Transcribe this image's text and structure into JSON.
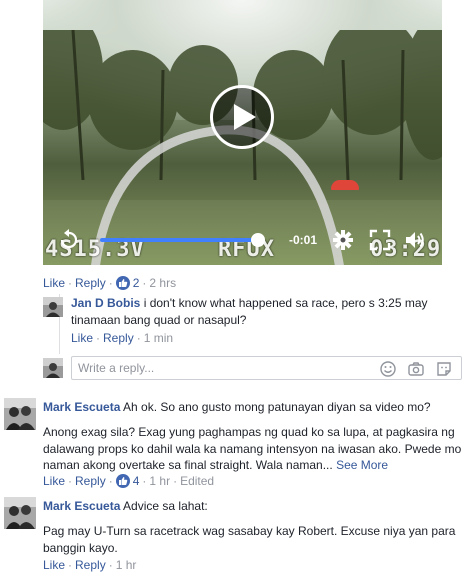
{
  "video": {
    "osd_left": "4S15.3V",
    "osd_mid": "RFUX",
    "osd_right": "03:29",
    "time_remaining": "-0:01",
    "progress_fraction": 0.96,
    "icons": [
      "play-icon",
      "rewind-icon",
      "gear-icon",
      "fullscreen-icon",
      "volume-icon"
    ]
  },
  "comment0": {
    "like": "Like",
    "reply": "Reply",
    "reactions": "2",
    "time": "2 hrs"
  },
  "reply_jan": {
    "author": "Jan D Bobis",
    "text": "i don't know what happened sa race, pero s 3:25 may tinamaan bang quad or nasapul?",
    "like": "Like",
    "reply": "Reply",
    "time": "1 min"
  },
  "reply_box": {
    "placeholder": "Write a reply...",
    "icons": [
      "emoji-icon",
      "camera-icon",
      "sticker-icon"
    ]
  },
  "comment_mark1": {
    "author": "Mark Escueta",
    "first_line": "Ah ok. So ano gusto mong patunayan diyan sa video mo?",
    "body": "Anong exag sila? Exag yung paghampas ng quad ko sa lupa, at pagkasira ng dalawang props ko dahil wala ka namang intensyon na iwasan ako. Pwede mo naman akong overtake sa final straight. Wala naman...",
    "see_more": "See More",
    "like": "Like",
    "reply": "Reply",
    "reactions": "4",
    "time": "1 hr",
    "edited": "Edited"
  },
  "comment_mark2": {
    "author": "Mark Escueta",
    "first_line": "Advice sa lahat:",
    "body": "Pag may U-Turn sa racetrack wag sasabay kay Robert. Excuse niya yan para banggin kayo.",
    "like": "Like",
    "reply": "Reply",
    "time": "1 hr"
  },
  "colors": {
    "link": "#365899",
    "meta": "#90949c",
    "like_badge": "#4267b2",
    "scrub_fill": "#4080ff"
  }
}
